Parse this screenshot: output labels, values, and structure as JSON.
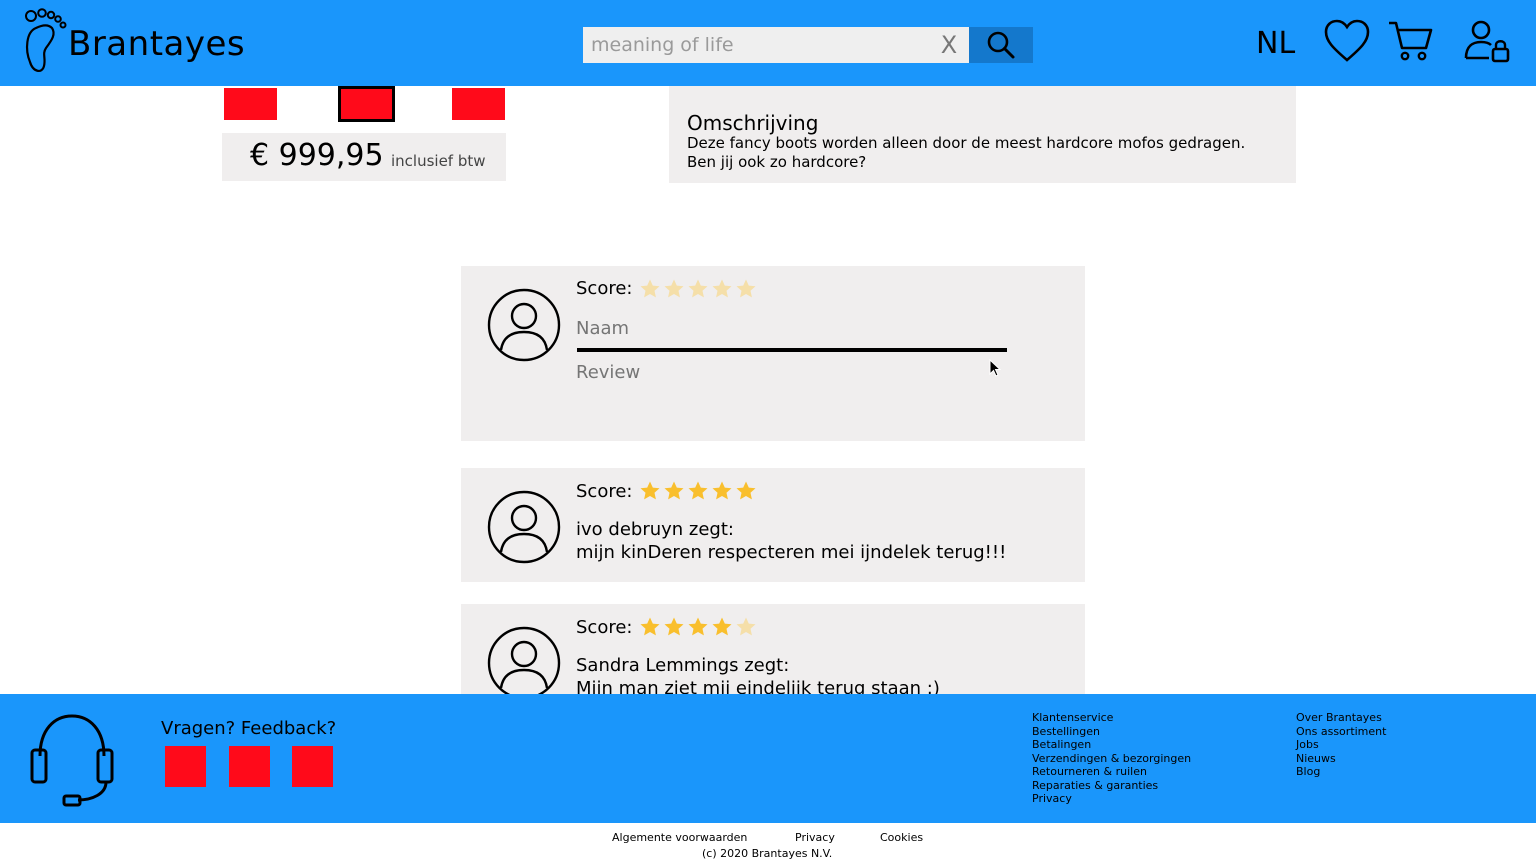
{
  "header": {
    "brand": "Brantayes",
    "search": {
      "value": "",
      "placeholder": "meaning of life",
      "clear": "X"
    },
    "language": "NL",
    "icons": {
      "logo": "foot-icon",
      "search": "search-icon",
      "wishlist": "heart-icon",
      "cart": "cart-icon",
      "account": "user-lock-icon"
    }
  },
  "product": {
    "price": "€ 999,95",
    "price_note": "inclusief btw",
    "description_title": "Omschrijving",
    "description": "Deze fancy boots worden alleen door de meest hardcore mofos gedragen. Ben jij ook zo hardcore?",
    "swatch_color": "#ff0a1a"
  },
  "review_form": {
    "score_label": "Score:",
    "rating": 0,
    "name_placeholder": "Naam",
    "review_placeholder": "Review"
  },
  "reviews": [
    {
      "score_label": "Score:",
      "rating": 5,
      "author_line": "ivo debruyn zegt:",
      "text": "mijn kinDeren respecteren mei ijndelek terug!!!"
    },
    {
      "score_label": "Score:",
      "rating": 4,
      "author_line": "Sandra Lemmings zegt:",
      "text": "Mijn man ziet mij eindelijk terug staan :)"
    }
  ],
  "footer": {
    "feedback": "Vragen? Feedback?",
    "links_col1": [
      "Klantenservice",
      "Bestellingen",
      "Betalingen",
      "Verzendingen & bezorgingen",
      "Retourneren & ruilen",
      "Reparaties & garanties",
      "Privacy"
    ],
    "links_col2": [
      "Over Brantayes",
      "Ons assortiment",
      "Jobs",
      "Nieuws",
      "Blog"
    ],
    "bottom_links": [
      "Algemente voorwaarden",
      "Privacy",
      "Cookies"
    ],
    "copyright": "(c) 2020 Brantayes N.V."
  },
  "colors": {
    "brand_blue": "#1a96fb",
    "search_button": "#1478cc",
    "star_gold": "#f9bf2d",
    "swatch_red": "#ff0a1a",
    "panel_gray": "#f0eeee"
  }
}
